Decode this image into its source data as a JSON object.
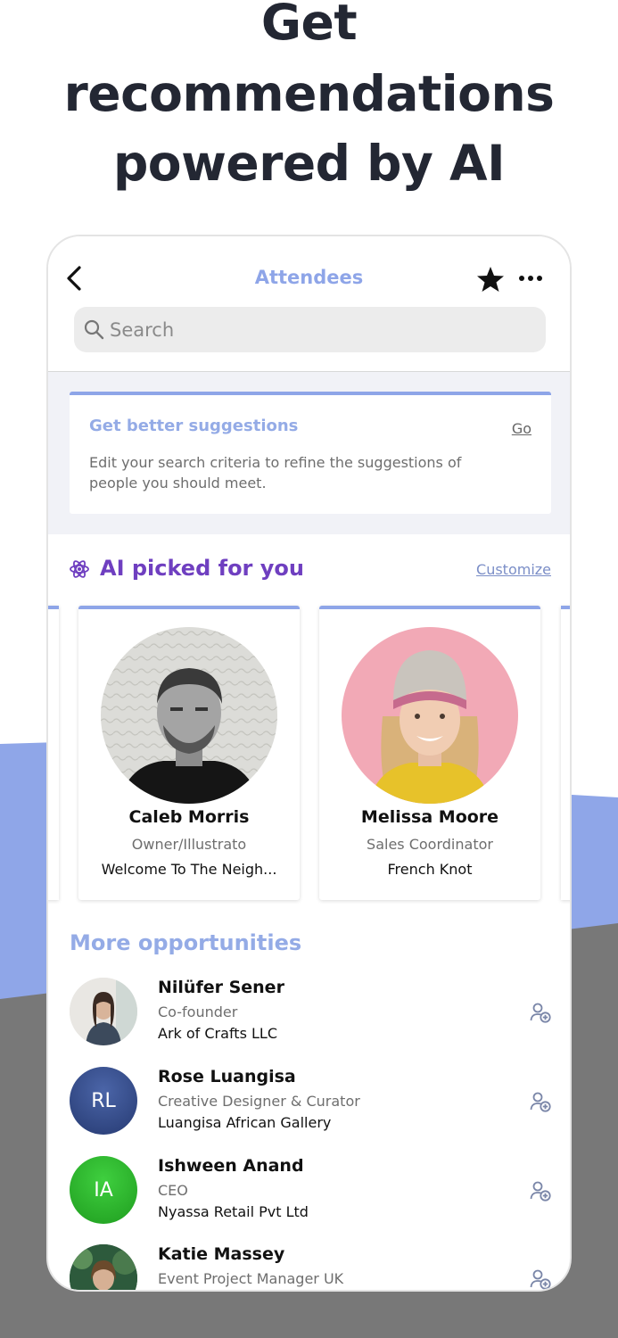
{
  "headline": {
    "line1": "Get",
    "line2": "recommendations",
    "line3": "powered by AI"
  },
  "topbar": {
    "title": "Attendees",
    "back_icon": "chevron-left-icon",
    "star_icon": "star-icon",
    "more_icon": "more-horizontal-icon"
  },
  "search": {
    "placeholder": "Search"
  },
  "suggestion": {
    "title": "Get better suggestions",
    "action": "Go",
    "description": "Edit your search criteria to refine the suggestions of people you should meet."
  },
  "ai_picked": {
    "title": "AI picked for you",
    "customize": "Customize",
    "cards": [
      {
        "name": "Caleb  Morris",
        "role": "Owner/Illustrato",
        "org": "Welcome To The Neigh..."
      },
      {
        "name": "Melissa Moore",
        "role": "Sales Coordinator",
        "org": "French Knot"
      }
    ]
  },
  "more_opportunities": {
    "title": "More opportunities",
    "items": [
      {
        "name": "Nilüfer Sener",
        "role": "Co-founder",
        "org": "Ark of Crafts LLC",
        "initials": ""
      },
      {
        "name": "Rose Luangisa",
        "role": "Creative Designer & Curator",
        "org": "Luangisa African Gallery",
        "initials": "RL"
      },
      {
        "name": "Ishween Anand",
        "role": "CEO",
        "org": "Nyassa Retail Pvt Ltd",
        "initials": "IA"
      },
      {
        "name": "Katie Massey",
        "role": "Event Project Manager UK",
        "org": "",
        "initials": ""
      }
    ]
  },
  "colors": {
    "accent_blue": "#8ea5e8",
    "ai_purple": "#6f3fc0",
    "headline": "#232733",
    "background_gray": "#787878"
  }
}
